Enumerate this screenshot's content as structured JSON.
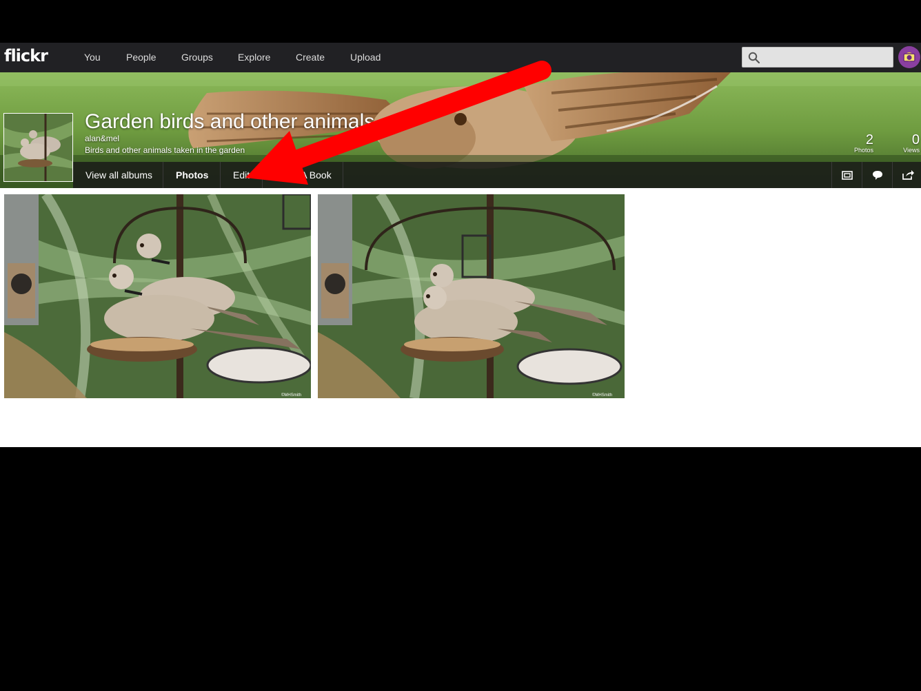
{
  "brand": {
    "logo_text": "flickr"
  },
  "nav": {
    "items": [
      {
        "label": "You"
      },
      {
        "label": "People"
      },
      {
        "label": "Groups"
      },
      {
        "label": "Explore"
      },
      {
        "label": "Create"
      },
      {
        "label": "Upload"
      }
    ],
    "search": {
      "placeholder": "",
      "icon": "search-icon"
    },
    "avatar": {
      "icon": "avatar"
    }
  },
  "album": {
    "title": "Garden birds and other animals",
    "owner": "alan&mel",
    "description": "Birds and other animals taken in the garden",
    "stats": {
      "photos": {
        "value": "2",
        "label": "Photos"
      },
      "views": {
        "value": "0",
        "label": "Views"
      }
    }
  },
  "subnav": {
    "items": [
      {
        "label": "View all albums"
      },
      {
        "label": "Photos"
      },
      {
        "label": "Edit"
      },
      {
        "label": "Make A Book"
      }
    ],
    "icons": [
      "slideshow-icon",
      "comment-icon",
      "share-icon"
    ]
  },
  "photos": [
    {
      "watermark": "©MHSmith"
    },
    {
      "watermark": "©MHSmith"
    }
  ],
  "colors": {
    "navbar": "#212124",
    "annotation_arrow": "#ff0000"
  }
}
